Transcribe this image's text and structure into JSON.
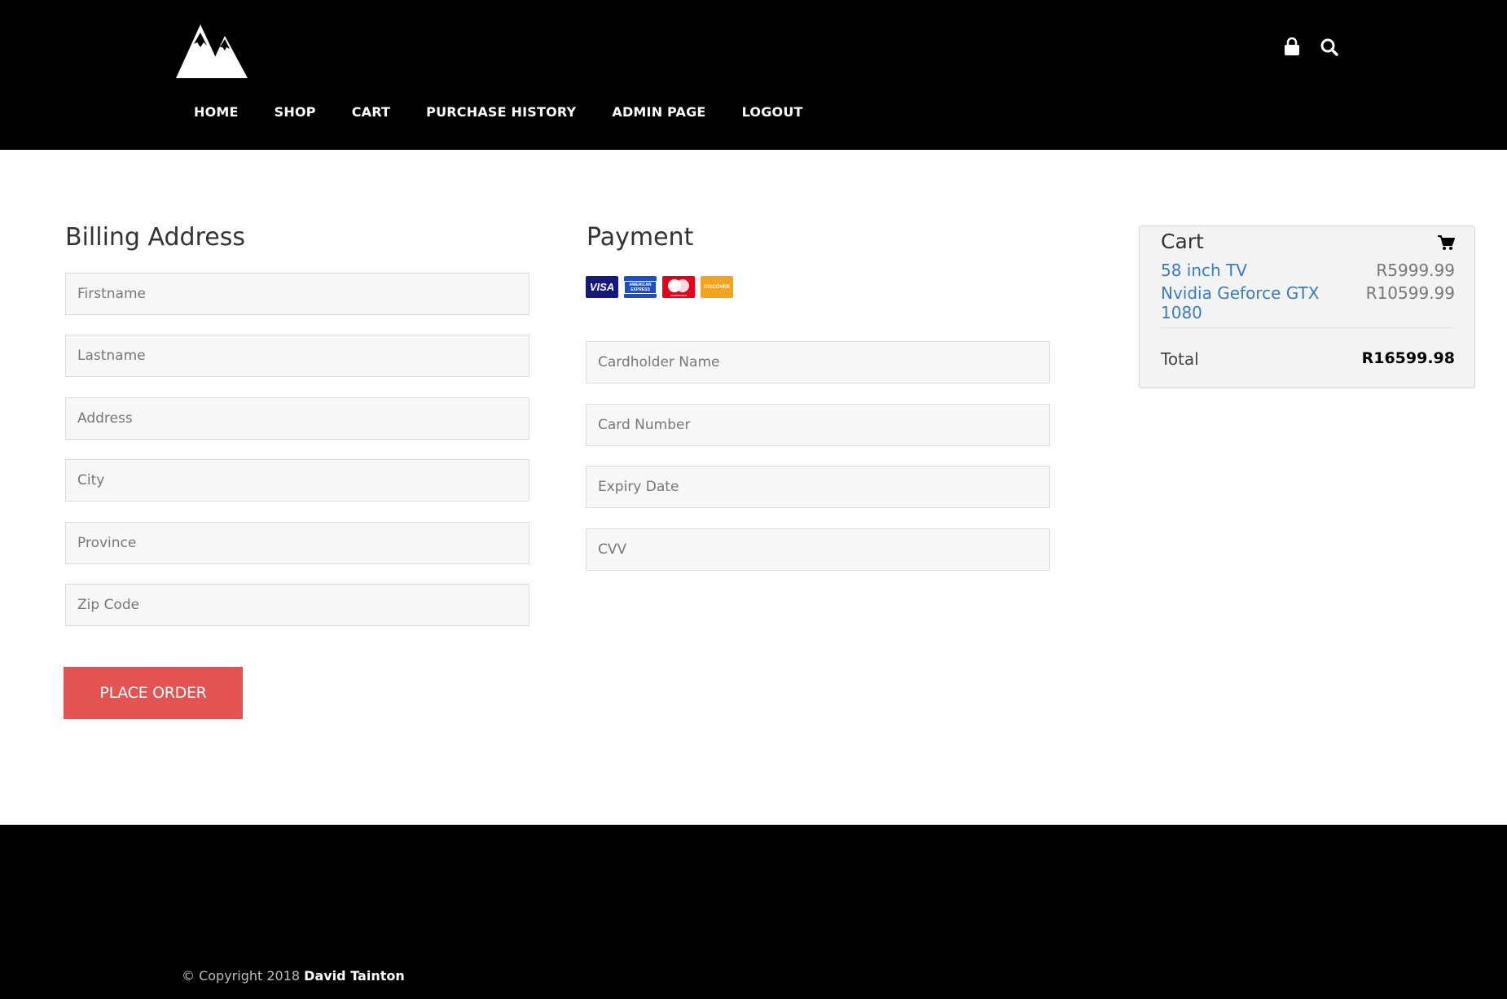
{
  "header": {
    "nav": [
      "HOME",
      "SHOP",
      "CART",
      "PURCHASE HISTORY",
      "ADMIN PAGE",
      "LOGOUT"
    ]
  },
  "billing": {
    "title": "Billing Address",
    "fields": {
      "firstname": "Firstname",
      "lastname": "Lastname",
      "address": "Address",
      "city": "City",
      "province": "Province",
      "zip": "Zip Code"
    },
    "button": "PLACE ORDER"
  },
  "payment": {
    "title": "Payment",
    "card_brands": [
      "VISA",
      "AMERICAN EXPRESS",
      "mastercard",
      "DISCOVER"
    ],
    "fields": {
      "cardholder": "Cardholder Name",
      "card_number": "Card Number",
      "expiry": "Expiry Date",
      "cvv": "CVV"
    }
  },
  "cart": {
    "title": "Cart",
    "items": [
      {
        "name": "58 inch TV",
        "price": "R5999.99"
      },
      {
        "name": "Nvidia Geforce GTX 1080",
        "price": "R10599.99"
      }
    ],
    "total_label": "Total",
    "total_value": "R16599.98"
  },
  "footer": {
    "copyright_prefix": "© Copyright 2018",
    "author": "David Tainton"
  },
  "colors": {
    "header_bg": "#000000",
    "accent_button": "#e25352",
    "link": "#3b7bbf"
  }
}
